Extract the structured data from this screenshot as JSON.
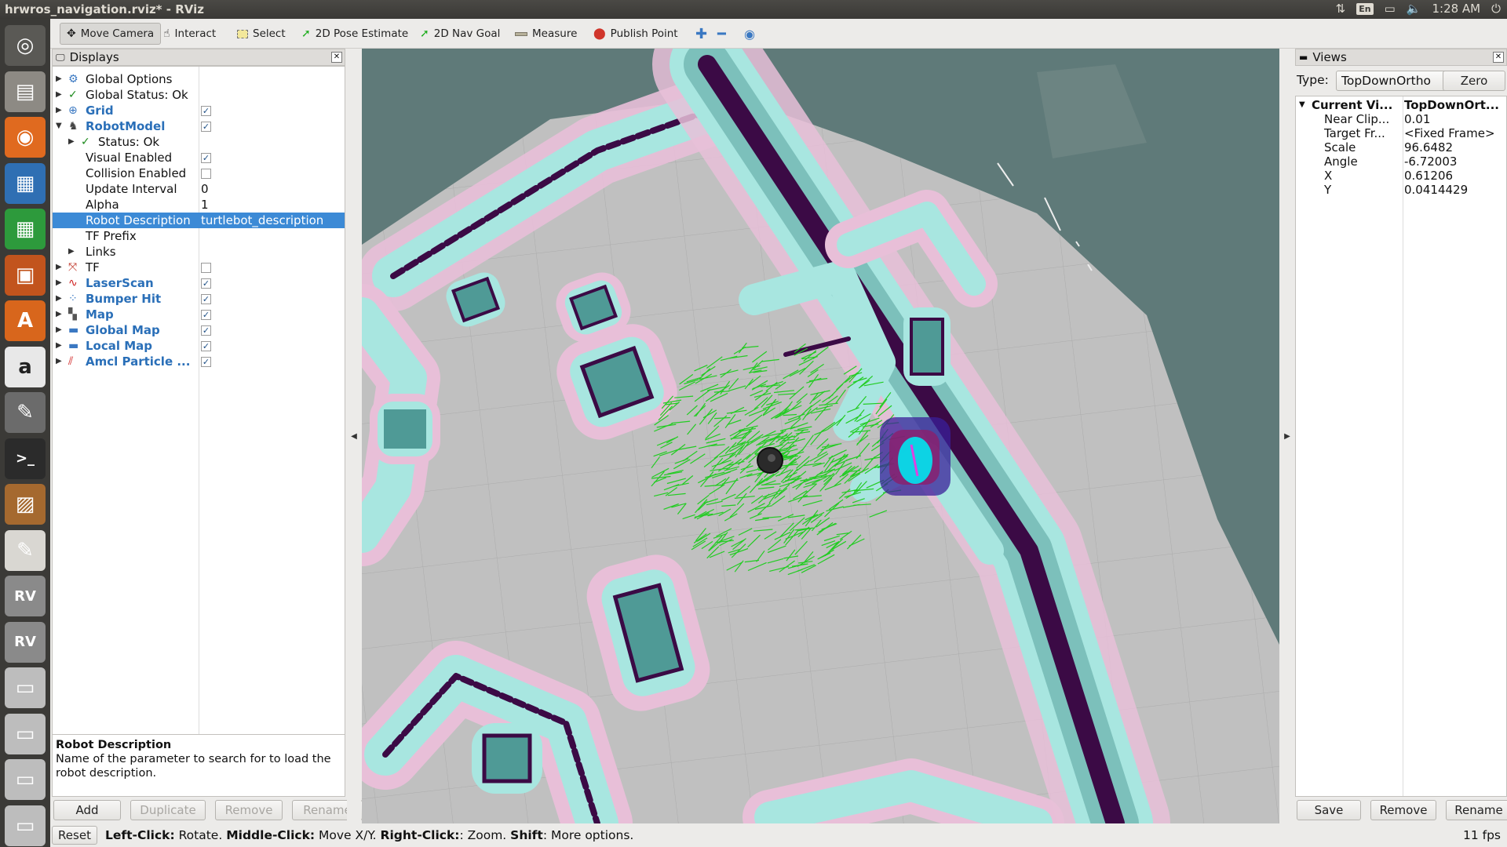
{
  "window": {
    "title": "hrwros_navigation.rviz* - RViz"
  },
  "tray": {
    "lang": "En",
    "time": "1:28 AM"
  },
  "launcher": [
    {
      "icon": "ubuntu-dash-icon",
      "bg": "#5a5955"
    },
    {
      "icon": "files-icon",
      "bg": "#8d8a84"
    },
    {
      "icon": "firefox-icon",
      "bg": "#e06a1f"
    },
    {
      "icon": "writer-icon",
      "bg": "#2f6fb3"
    },
    {
      "icon": "calc-icon",
      "bg": "#2d9a3c"
    },
    {
      "icon": "impress-icon",
      "bg": "#c2541d"
    },
    {
      "icon": "software-center-icon",
      "bg": "#d8661c"
    },
    {
      "icon": "amazon-icon",
      "bg": "#e8e8e8"
    },
    {
      "icon": "settings-icon",
      "bg": "#6b6b6b"
    },
    {
      "icon": "terminal-icon",
      "bg": "#2b2b2b"
    },
    {
      "icon": "box-icon",
      "bg": "#a5692f"
    },
    {
      "icon": "text-editor-icon",
      "bg": "#d9d7d2"
    },
    {
      "icon": "rviz-icon",
      "bg": "#8a8a8a"
    },
    {
      "icon": "rviz-icon",
      "bg": "#8a8a8a"
    },
    {
      "icon": "drive-icon",
      "bg": "#bdbdbd"
    },
    {
      "icon": "drive-icon",
      "bg": "#bdbdbd"
    },
    {
      "icon": "drive-icon",
      "bg": "#bdbdbd"
    },
    {
      "icon": "drive-icon",
      "bg": "#bdbdbd"
    }
  ],
  "toolbar": {
    "move_camera": "Move Camera",
    "interact": "Interact",
    "select": "Select",
    "pose_estimate": "2D Pose Estimate",
    "nav_goal": "2D Nav Goal",
    "measure": "Measure",
    "publish_point": "Publish Point"
  },
  "displays": {
    "title": "Displays",
    "rows": [
      {
        "label": "Global Options",
        "value": "",
        "indent": 0,
        "icon": "globe-icon",
        "arrow": "▶",
        "checkbox": null,
        "blue": false
      },
      {
        "label": "Global Status: Ok",
        "value": "",
        "indent": 0,
        "icon": "check-icon",
        "arrow": "▶",
        "checkbox": null,
        "blue": false
      },
      {
        "label": "Grid",
        "value": "",
        "indent": 0,
        "icon": "grid-icon",
        "arrow": "▶",
        "checkbox": true,
        "blue": true
      },
      {
        "label": "RobotModel",
        "value": "",
        "indent": 0,
        "icon": "robot-icon",
        "arrow": "▼",
        "checkbox": true,
        "blue": true
      },
      {
        "label": "Status: Ok",
        "value": "",
        "indent": 1,
        "icon": "check-icon",
        "arrow": "▶",
        "checkbox": null,
        "blue": false
      },
      {
        "label": "Visual Enabled",
        "value": "",
        "indent": 1,
        "icon": "",
        "arrow": "",
        "checkbox": true,
        "blue": false
      },
      {
        "label": "Collision Enabled",
        "value": "",
        "indent": 1,
        "icon": "",
        "arrow": "",
        "checkbox": false,
        "blue": false
      },
      {
        "label": "Update Interval",
        "value": "0",
        "indent": 1,
        "icon": "",
        "arrow": "",
        "checkbox": null,
        "blue": false
      },
      {
        "label": "Alpha",
        "value": "1",
        "indent": 1,
        "icon": "",
        "arrow": "",
        "checkbox": null,
        "blue": false
      },
      {
        "label": "Robot Description",
        "value": "turtlebot_description",
        "indent": 1,
        "icon": "",
        "arrow": "",
        "checkbox": null,
        "blue": false,
        "selected": true
      },
      {
        "label": "TF Prefix",
        "value": "",
        "indent": 1,
        "icon": "",
        "arrow": "",
        "checkbox": null,
        "blue": false
      },
      {
        "label": "Links",
        "value": "",
        "indent": 1,
        "icon": "",
        "arrow": "▶",
        "checkbox": null,
        "blue": false
      },
      {
        "label": "TF",
        "value": "",
        "indent": 0,
        "icon": "tf-icon",
        "arrow": "▶",
        "checkbox": false,
        "blue": false
      },
      {
        "label": "LaserScan",
        "value": "",
        "indent": 0,
        "icon": "laser-icon",
        "arrow": "▶",
        "checkbox": true,
        "blue": true
      },
      {
        "label": "Bumper Hit",
        "value": "",
        "indent": 0,
        "icon": "points-icon",
        "arrow": "▶",
        "checkbox": true,
        "blue": true
      },
      {
        "label": "Map",
        "value": "",
        "indent": 0,
        "icon": "map-icon",
        "arrow": "▶",
        "checkbox": true,
        "blue": true
      },
      {
        "label": "Global Map",
        "value": "",
        "indent": 0,
        "icon": "folder-icon",
        "arrow": "▶",
        "checkbox": true,
        "blue": true
      },
      {
        "label": "Local Map",
        "value": "",
        "indent": 0,
        "icon": "folder-icon",
        "arrow": "▶",
        "checkbox": true,
        "blue": true
      },
      {
        "label": "Amcl Particle ...",
        "value": "",
        "indent": 0,
        "icon": "pose-array-icon",
        "arrow": "▶",
        "checkbox": true,
        "blue": true
      }
    ],
    "desc_title": "Robot Description",
    "desc_text": "Name of the parameter to search for to load the robot description.",
    "buttons": {
      "add": "Add",
      "duplicate": "Duplicate",
      "remove": "Remove",
      "rename": "Rename"
    }
  },
  "views": {
    "title": "Views",
    "type_label": "Type:",
    "type_value": "TopDownOrtho",
    "zero": "Zero",
    "rows": [
      {
        "label": "Current Vi...",
        "value": "TopDownOrt...",
        "bold": true
      },
      {
        "label": "Near Clip...",
        "value": "0.01",
        "bold": false
      },
      {
        "label": "Target Fr...",
        "value": "<Fixed Frame>",
        "bold": false
      },
      {
        "label": "Scale",
        "value": "96.6482",
        "bold": false
      },
      {
        "label": "Angle",
        "value": "-6.72003",
        "bold": false
      },
      {
        "label": "X",
        "value": "0.61206",
        "bold": false
      },
      {
        "label": "Y",
        "value": "0.0414429",
        "bold": false
      }
    ],
    "buttons": {
      "save": "Save",
      "remove": "Remove",
      "rename": "Rename"
    }
  },
  "status": {
    "reset": "Reset",
    "hint_parts": [
      {
        "b": "Left-Click:",
        "t": " Rotate. "
      },
      {
        "b": "Middle-Click:",
        "t": " Move X/Y. "
      },
      {
        "b": "Right-Click:",
        "t": ": Zoom. "
      },
      {
        "b": "Shift",
        "t": ": More options."
      }
    ],
    "fps": "11 fps"
  },
  "colors": {
    "map_bg": "#5f7a79",
    "free": "#c0c0c0",
    "wall": "#3b0a45",
    "inflation_cyan": "#a8e6e0",
    "inflation_pink": "#e8bfd8",
    "inflation_teal": "#4f9a96",
    "particles": "#22cc22",
    "selection": "#3c8ad6"
  }
}
